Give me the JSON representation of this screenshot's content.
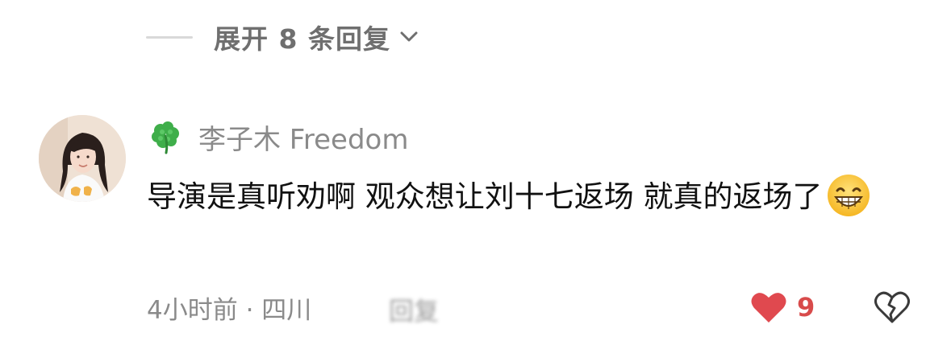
{
  "expand": {
    "label": "展开 8 条回复"
  },
  "comment": {
    "user_name": "李子木 Freedom",
    "text": "导演是真听劝啊 观众想让刘十七返场 就真的返场了",
    "emoji": "grinning-face-with-smiling-eyes",
    "time_location": "4小时前 · 四川",
    "reply_label": "回复",
    "likes": "9"
  },
  "colors": {
    "like_red": "#e0494f",
    "muted_gray": "#8a8a8a",
    "clover_green": "#3fae4a"
  }
}
